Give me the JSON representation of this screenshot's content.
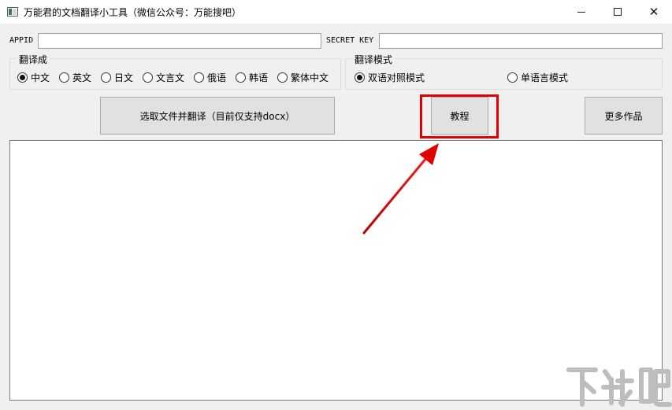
{
  "window": {
    "title": "万能君的文档翻译小工具（微信公众号：万能搜吧）",
    "icon": "app-window-icon",
    "controls": {
      "minimize_icon": "minimize-icon",
      "maximize_icon": "maximize-icon",
      "close_icon": "close-icon"
    }
  },
  "credentials": {
    "appid_label": "APPID",
    "appid_value": "",
    "secret_label": "SECRET KEY",
    "secret_value": ""
  },
  "target_language": {
    "group_title": "翻译成",
    "options": [
      {
        "label": "中文",
        "checked": true
      },
      {
        "label": "英文",
        "checked": false
      },
      {
        "label": "日文",
        "checked": false
      },
      {
        "label": "文言文",
        "checked": false
      },
      {
        "label": "俄语",
        "checked": false
      },
      {
        "label": "韩语",
        "checked": false
      },
      {
        "label": "繁体中文",
        "checked": false
      }
    ]
  },
  "translation_mode": {
    "group_title": "翻译模式",
    "options": [
      {
        "label": "双语对照模式",
        "checked": true
      },
      {
        "label": "单语言模式",
        "checked": false
      }
    ]
  },
  "buttons": {
    "select_file": "选取文件并翻译（目前仅支持docx）",
    "tutorial": "教程",
    "more_works": "更多作品"
  },
  "annotation": {
    "highlight_color": "#e30000",
    "arrow_color": "#d40000"
  },
  "watermark": {
    "text": "下载吧",
    "color": "#bdbdbd"
  }
}
